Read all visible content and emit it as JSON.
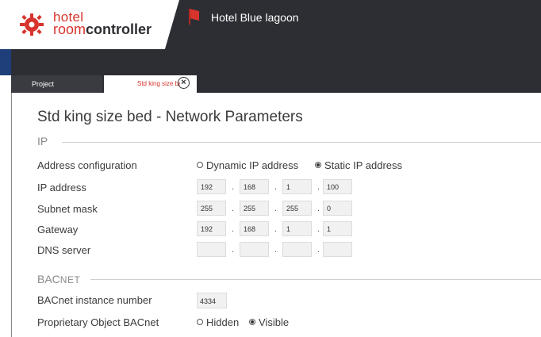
{
  "header": {
    "logo_line1": "hotel",
    "logo_line2_a": "room",
    "logo_line2_b": "controller",
    "hotel_name": "Hotel Blue lagoon"
  },
  "tabs": [
    {
      "label": "Project"
    },
    {
      "label": "Std king size bed"
    }
  ],
  "page": {
    "title": "Std king size bed - Network Parameters"
  },
  "ip_section": {
    "heading": "IP",
    "address_config_label": "Address configuration",
    "address_options": [
      "Dynamic IP address",
      "Static IP address"
    ],
    "selected": "Static IP address",
    "fields": [
      {
        "label": "IP address",
        "octets": [
          "192",
          "168",
          "1",
          "100"
        ]
      },
      {
        "label": "Subnet mask",
        "octets": [
          "255",
          "255",
          "255",
          "0"
        ]
      },
      {
        "label": "Gateway",
        "octets": [
          "192",
          "168",
          "1",
          "1"
        ]
      },
      {
        "label": "DNS server",
        "octets": [
          "",
          "",
          "",
          ""
        ]
      }
    ]
  },
  "bacnet_section": {
    "heading_a": "BAC",
    "heading_b": "NET",
    "instance_label": "BACnet instance number",
    "instance_value": "4334",
    "proprietary_label": "Proprietary Object BACnet",
    "proprietary_options": [
      "Hidden",
      "Visible"
    ],
    "proprietary_selected": "Visible"
  },
  "colors": {
    "accent": "#d7342e",
    "topbar": "#2d2e33",
    "text": "#3b3b3b"
  }
}
